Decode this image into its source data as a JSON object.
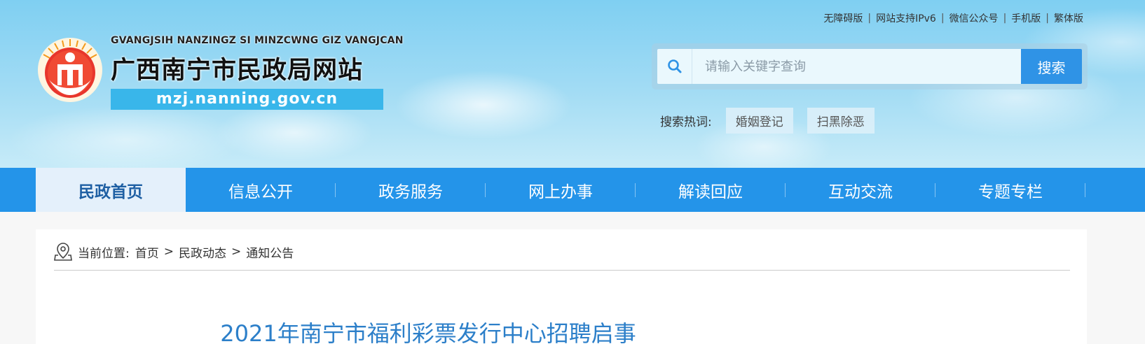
{
  "top_links": [
    "无障碍版",
    "网站支持IPv6",
    "微信公众号",
    "手机版",
    "繁体版"
  ],
  "logo": {
    "pinyin": "GVANGJSIH NANZINGZ SI MINZCWNG GIZ VANGJCAN",
    "name": "广西南宁市民政局网站",
    "domain": "mzj.nanning.gov.cn"
  },
  "search": {
    "placeholder": "请输入关键字查询",
    "value": "",
    "button_label": "搜索",
    "hot_label": "搜索热词:",
    "hot_terms": [
      "婚姻登记",
      "扫黑除恶"
    ]
  },
  "nav": {
    "items": [
      "民政首页",
      "信息公开",
      "政务服务",
      "网上办事",
      "解读回应",
      "互动交流",
      "专题专栏"
    ],
    "active_index": 0
  },
  "breadcrumb": {
    "label": "当前位置:",
    "items": [
      "首页",
      "民政动态",
      "通知公告"
    ],
    "separator": ">"
  },
  "article": {
    "title": "2021年南宁市福利彩票发行中心招聘启事"
  },
  "colors": {
    "nav_bg": "#2494e9",
    "search_button": "#2f93e6",
    "title_blue": "#2c7fc9",
    "domain_band": "#39b6ea"
  },
  "icons": [
    "emblem-logo",
    "search-icon",
    "location-pin-icon"
  ]
}
